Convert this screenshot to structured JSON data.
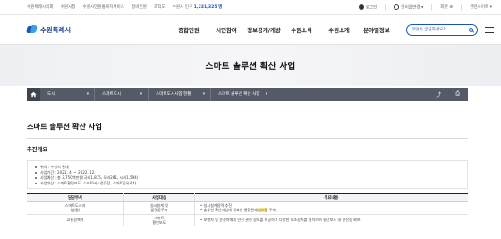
{
  "utility": {
    "left_links": [
      "수원특례시의회",
      "수원시청",
      "수원시민원통복지서비스",
      "정비민원",
      "조직도"
    ],
    "population_label": "수원시 인구",
    "population_value": "1,231,325 명",
    "login": "로그인",
    "language": "언어를변경",
    "zoom": "화면",
    "related_sites": "관련사이트"
  },
  "header": {
    "logo": "수원특례시",
    "menu": [
      "종합민원",
      "시민참여",
      "정보공개/개방",
      "수원소식",
      "수원소개",
      "분야별정보"
    ],
    "search_placeholder": "무엇이 궁금하세요?"
  },
  "banner": {
    "title": "스마트 솔루션 확산 사업"
  },
  "breadcrumb": {
    "items": [
      "도시",
      "스마트도시",
      "스마트도시사업 현황",
      "스마트 솔루션 확산 사업"
    ],
    "share_icon": "share-icon",
    "print_icon": "print-icon"
  },
  "content": {
    "title": "스마트 솔루션 확산 사업",
    "section": "추진개요",
    "overview": [
      "위치 : 수원시 관내",
      "사업기간 : 2021. 4. ~ 2022. 12.",
      "사업예산 : 총 3,750백만원(국비1,875, 도비281, 시비1,594)",
      "사업대상 : 스마트횡단보도, 스마트버스정류장, 스마트공유주차"
    ],
    "table": {
      "headers": [
        "담당부서",
        "사업대상",
        "주요내용"
      ],
      "rows": [
        {
          "dept": [
            "스마트도시과",
            "(총괄)"
          ],
          "target": [
            "실시설계 및",
            "플랫폼구축"
          ],
          "content": [
            "실시설계용역 추진",
            "솔루션 확산사업에 필요한 통합관제시스템 구축"
          ],
          "highlight": "시스템"
        },
        {
          "dept": [
            "교통정책과"
          ],
          "target": [
            "스마트",
            "횡단보도"
          ],
          "content": [
            "보행자 및 운전자에게 안전 관련 정보를 제공하고 다양한 보조장치를 설치하여 횡단보도 내 안전성 확보"
          ],
          "highlight": ""
        }
      ]
    }
  },
  "colors": {
    "brand": "#1a56b8",
    "location_bar": "#545b66",
    "highlight": "#ffe98a"
  }
}
